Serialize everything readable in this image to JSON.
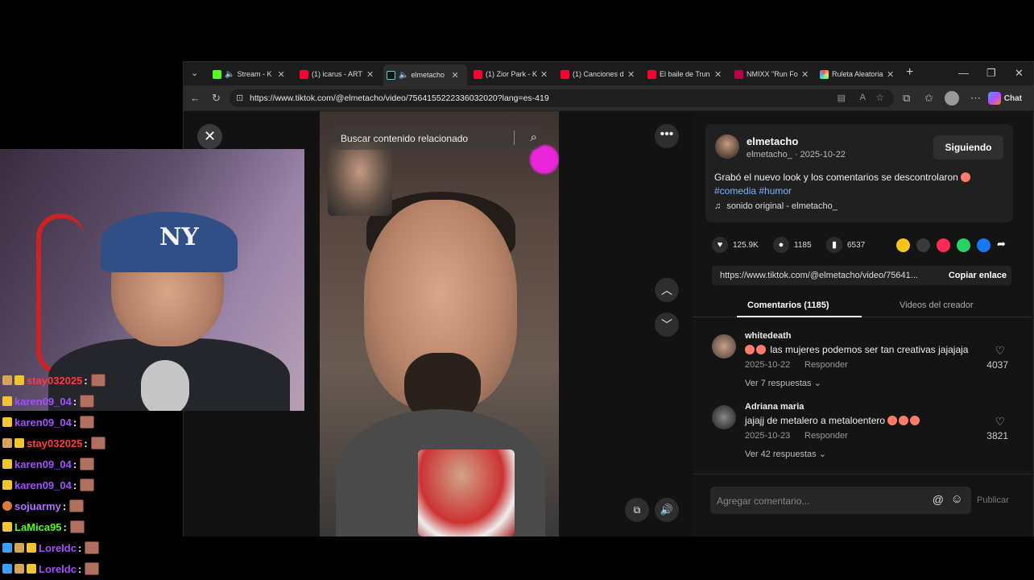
{
  "browser": {
    "tabs": [
      {
        "label": "Stream - K",
        "color": "#53fc18"
      },
      {
        "label": "(1) icarus - ART",
        "color": "#ff0033"
      },
      {
        "label": "elmetacho",
        "color": "#111111"
      },
      {
        "label": "(1) Zior Park - K",
        "color": "#ff0033"
      },
      {
        "label": "(1) Canciones d",
        "color": "#ff0033"
      },
      {
        "label": "El baile de Trun",
        "color": "#ff0033"
      },
      {
        "label": "NMIXX \"Run Fo",
        "color": "#c0004a"
      },
      {
        "label": "Ruleta Aleatoria",
        "color": "#3aa0ff"
      }
    ],
    "url": "https://www.tiktok.com/@elmetacho/video/7564155222336032020?lang=es-419",
    "chat_label": "Chat"
  },
  "video": {
    "search_placeholder": "Buscar contenido relacionado"
  },
  "post": {
    "author": "elmetacho",
    "handle": "elmetacho_",
    "date": "2025-10-22",
    "follow_label": "Siguiendo",
    "description": "Grabó el nuevo look y los comentarios se descontrolaron",
    "hashtags": "#comedia #humor",
    "music": "sonido original - elmetacho_",
    "likes": "125.9K",
    "comments": "1185",
    "saves": "6537",
    "link": "https://www.tiktok.com/@elmetacho/video/75641...",
    "copy_label": "Copiar enlace",
    "tab_comments": "Comentarios (1185)",
    "tab_creator": "Videos del creador"
  },
  "comments": [
    {
      "user": "whitedeath",
      "text": "las mujeres podemos ser tan creativas jajajaja",
      "date": "2025-10-22",
      "reply": "Responder",
      "more": "Ver 7 respuestas",
      "likes": "4037"
    },
    {
      "user": "Adriana maria",
      "text": "jajajj de metalero a metaloentero",
      "date": "2025-10-23",
      "reply": "Responder",
      "more": "Ver 42 respuestas",
      "likes": "3821"
    }
  ],
  "comment_box": {
    "placeholder": "Agregar comentario...",
    "publish": "Publicar"
  },
  "stream_chat": [
    {
      "user": "stay032025",
      "color": "#ff3b3b"
    },
    {
      "user": "karen09_04",
      "color": "#a64dff"
    },
    {
      "user": "karen09_04",
      "color": "#a64dff"
    },
    {
      "user": "stay032025",
      "color": "#ff3b3b"
    },
    {
      "user": "karen09_04",
      "color": "#a64dff"
    },
    {
      "user": "karen09_04",
      "color": "#a64dff"
    },
    {
      "user": "sojuarmy",
      "color": "#b46cff"
    },
    {
      "user": "LaMica95",
      "color": "#53fc18"
    },
    {
      "user": "Loreldc",
      "color": "#a64dff"
    },
    {
      "user": "Loreldc",
      "color": "#a64dff"
    }
  ]
}
